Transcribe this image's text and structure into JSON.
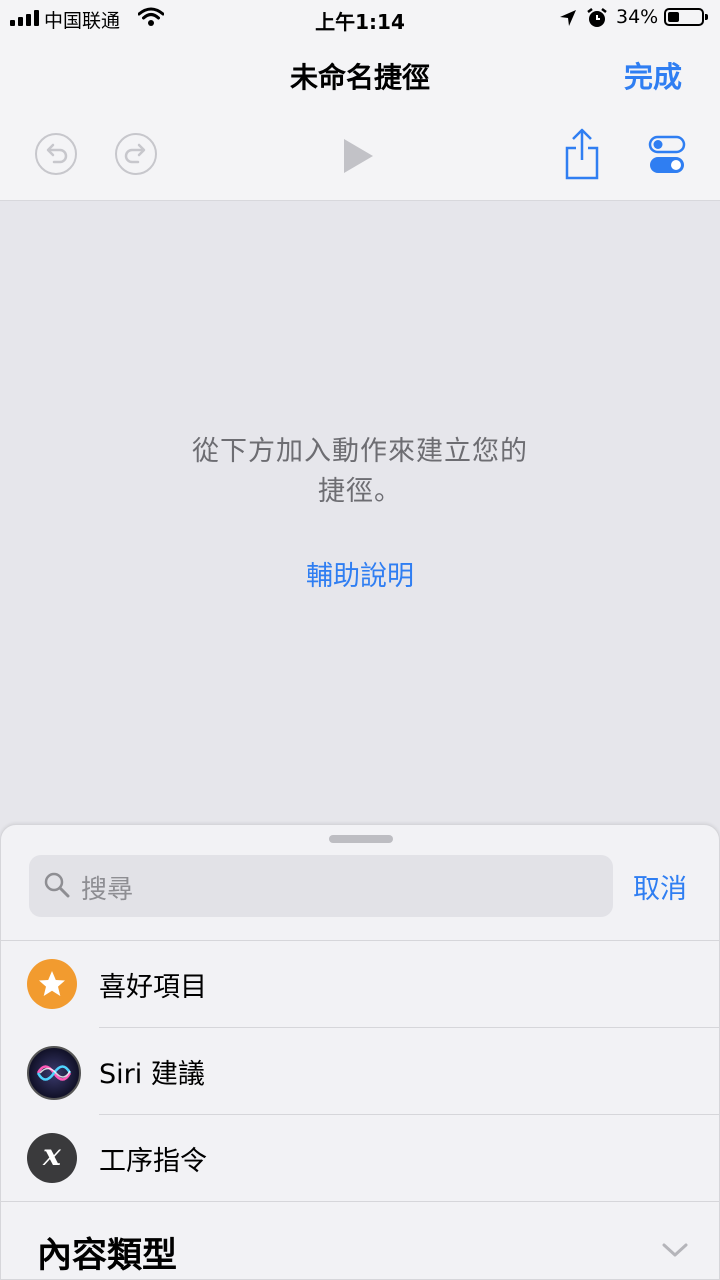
{
  "status_bar": {
    "carrier": "中国联通",
    "time": "上午1:14",
    "battery_percent": "34%",
    "battery_level": 0.34
  },
  "nav": {
    "title": "未命名捷徑",
    "done_label": "完成"
  },
  "toolbar": {
    "undo_icon": "undo-icon",
    "redo_icon": "redo-icon",
    "play_icon": "play-icon",
    "share_icon": "share-icon",
    "settings_icon": "toggle-settings-icon"
  },
  "empty_state": {
    "message_line1": "從下方加入動作來建立您的",
    "message_line2": "捷徑。",
    "help_link": "輔助說明"
  },
  "sheet": {
    "search": {
      "placeholder": "搜尋",
      "cancel_label": "取消"
    },
    "items": [
      {
        "label": "喜好項目",
        "icon": "star-icon",
        "color": "#f29b2f"
      },
      {
        "label": "Siri 建議",
        "icon": "siri-icon",
        "color": "#1c1c3a"
      },
      {
        "label": "工序指令",
        "icon": "variable-x-icon",
        "color": "#3a3a3c"
      }
    ],
    "section_title": "內容類型"
  },
  "colors": {
    "accent": "#2f7ef2",
    "background": "#e6e6eb"
  }
}
